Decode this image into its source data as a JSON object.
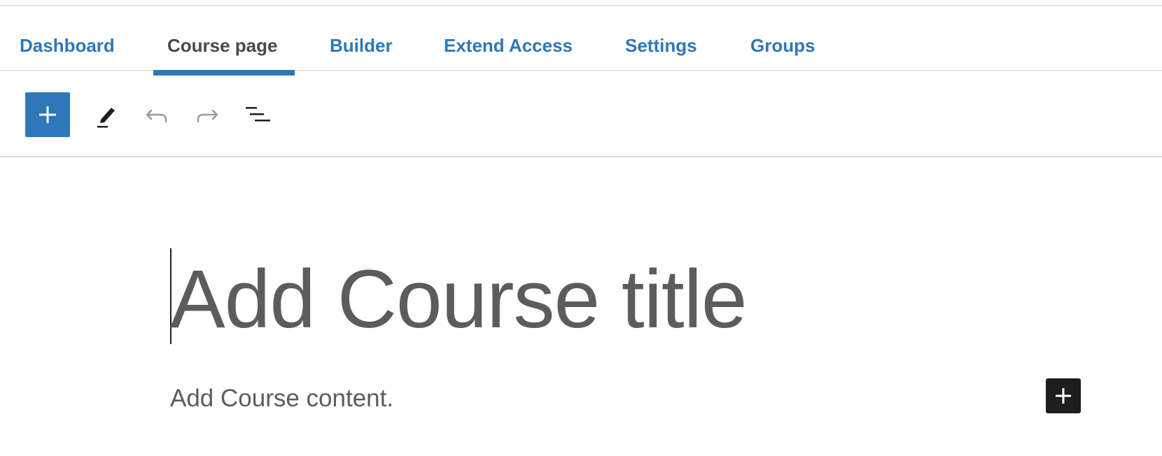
{
  "tabs": [
    {
      "label": "Dashboard",
      "active": false
    },
    {
      "label": "Course page",
      "active": true
    },
    {
      "label": "Builder",
      "active": false
    },
    {
      "label": "Extend Access",
      "active": false
    },
    {
      "label": "Settings",
      "active": false
    },
    {
      "label": "Groups",
      "active": false
    }
  ],
  "toolbar": {
    "icons": [
      "plus-icon",
      "pencil-icon",
      "undo-icon",
      "redo-icon",
      "list-view-icon"
    ]
  },
  "editor": {
    "title_placeholder": "Add Course title",
    "content_placeholder": "Add Course content."
  },
  "colors": {
    "accent": "#2f77b8",
    "active_tab_text": "#4a4a4a",
    "placeholder_text": "#5c5c5c",
    "dark_button": "#1e1e1e",
    "disabled_icon": "#9a9a9a"
  }
}
